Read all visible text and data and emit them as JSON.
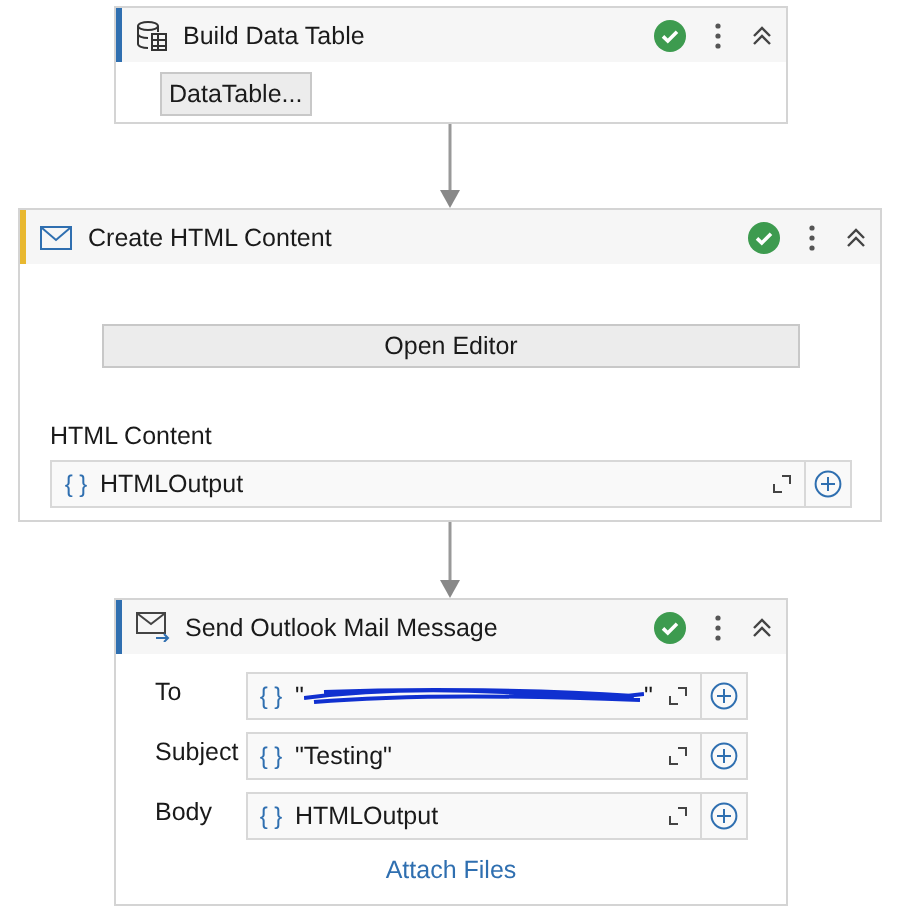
{
  "activities": [
    {
      "kind": "table",
      "title": "Build Data Table",
      "color": "#2f6fb0",
      "valid": true,
      "button": "DataTable..."
    },
    {
      "kind": "html",
      "title": "Create HTML Content",
      "color": "#e8b830",
      "valid": true,
      "button": "Open Editor",
      "field_label": "HTML Content",
      "field": {
        "icon": "{ }",
        "value": "HTMLOutput",
        "redacted": false
      }
    },
    {
      "kind": "mail",
      "title": "Send Outlook Mail Message",
      "color": "#2f6fb0",
      "valid": true,
      "fields": [
        {
          "label": "To",
          "icon": "{ }",
          "value": "\"",
          "redacted": true,
          "value_end": "\""
        },
        {
          "label": "Subject",
          "icon": "{ }",
          "value": "\"Testing\"",
          "redacted": false
        },
        {
          "label": "Body",
          "icon": "{ }",
          "value": "HTMLOutput",
          "redacted": false
        }
      ],
      "link": "Attach Files"
    }
  ]
}
